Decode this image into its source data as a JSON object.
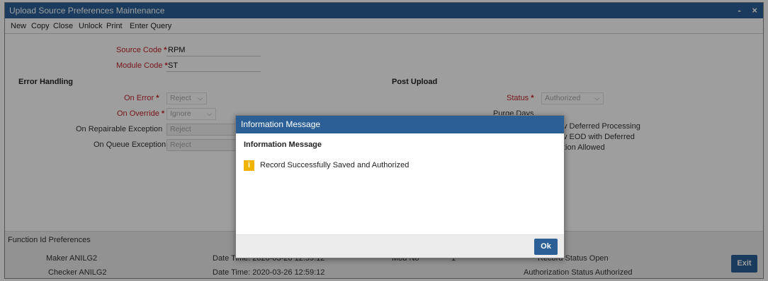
{
  "window": {
    "title": "Upload Source Preferences Maintenance",
    "minimize": "-",
    "close": "×"
  },
  "menu": [
    "New",
    "Copy",
    "Close",
    "Unlock",
    "Print",
    "Enter Query"
  ],
  "form": {
    "source_code_label": "Source Code",
    "source_code_value": "RPM",
    "module_code_label": "Module Code",
    "module_code_value": "ST",
    "required_mark": "*",
    "error_handling": {
      "section": "Error Handling",
      "on_error_label": "On Error",
      "on_error_value": "Reject",
      "on_override_label": "On Override",
      "on_override_value": "Ignore",
      "on_repairable_label": "On Repairable Exception",
      "on_repairable_value": "Reject",
      "on_queue_label": "On Queue Exception",
      "on_queue_value": "Reject"
    },
    "post_upload": {
      "section": "Post Upload",
      "status_label": "Status",
      "status_value": "Authorized",
      "purge_days_label": "Purge Days",
      "opt1_text": "v Deferred Processing",
      "opt2_text": "v EOD with Deferred",
      "opt3_text": "tion Allowed"
    }
  },
  "function_id_preferences": "Function Id Preferences",
  "audit": {
    "maker": "Maker ANILG2",
    "checker": "Checker ANILG2",
    "maker_date": "Date Time: 2020-03-26 12:59:12",
    "checker_date": "Date Time: 2020-03-26 12:59:12",
    "mod_no": "Mod No",
    "mod_no_value": "1",
    "record_status": "Record Status Open",
    "auth_status": "Authorization Status Authorized",
    "exit_label": "Exit"
  },
  "dialog": {
    "title": "Information Message",
    "body_title": "Information Message",
    "icon": "info-icon",
    "icon_glyph": "i",
    "message": "Record Successfully Saved and Authorized",
    "ok_label": "Ok"
  },
  "colors": {
    "titlebar": "#2b5f96",
    "required": "#c0262d",
    "info_icon": "#f0b400"
  }
}
